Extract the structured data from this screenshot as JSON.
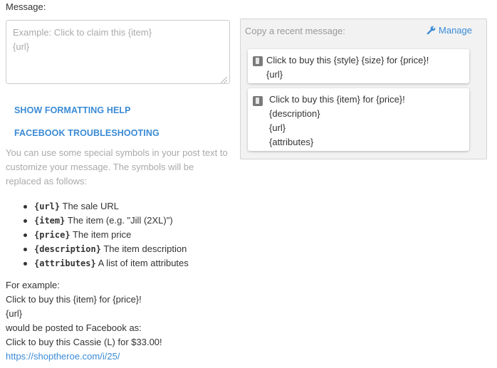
{
  "message": {
    "label": "Message:",
    "placeholder": "Example: Click to claim this {item}\n{url}",
    "value": ""
  },
  "links": {
    "formatting_help": "SHOW FORMATTING HELP",
    "facebook_troubleshooting": "FACEBOOK TROUBLESHOOTING"
  },
  "help": {
    "line1": "You can use some special symbols in your post text to",
    "line2": "customize your message. The symbols will be",
    "line3": "replaced as follows:",
    "symbols": [
      {
        "code": "{url}",
        "desc": "The sale URL"
      },
      {
        "code": "{item}",
        "desc": "The item (e.g. \"Jill (2XL)\")"
      },
      {
        "code": "{price}",
        "desc": "The item price"
      },
      {
        "code": "{description}",
        "desc": "The item description"
      },
      {
        "code": "{attributes}",
        "desc": "A list of item attributes"
      }
    ]
  },
  "example": {
    "intro": "For example:",
    "template_line1": "Click to buy this {item} for {price}!",
    "template_line2": "{url}",
    "posted_as": "would be posted to Facebook as:",
    "result_line1": "Click to buy this Cassie (L) for $33.00!",
    "result_url": "https://shoptheroe.com/i/25/"
  },
  "recent": {
    "title": "Copy a recent message:",
    "manage_label": "Manage",
    "manage_icon": "wrench-icon",
    "messages": [
      {
        "icon": "copy-icon",
        "lines": [
          "Click to buy this {style} {size} for {price}!",
          "{url}"
        ]
      },
      {
        "icon": "copy-icon",
        "lines": [
          "Click to buy this {item} for {price}!",
          "{description}",
          "{url}",
          "{attributes}"
        ]
      }
    ]
  },
  "colors": {
    "accent": "#3a8bd6",
    "muted_text": "#aaaaaa",
    "panel_bg": "#f2f2f2"
  }
}
